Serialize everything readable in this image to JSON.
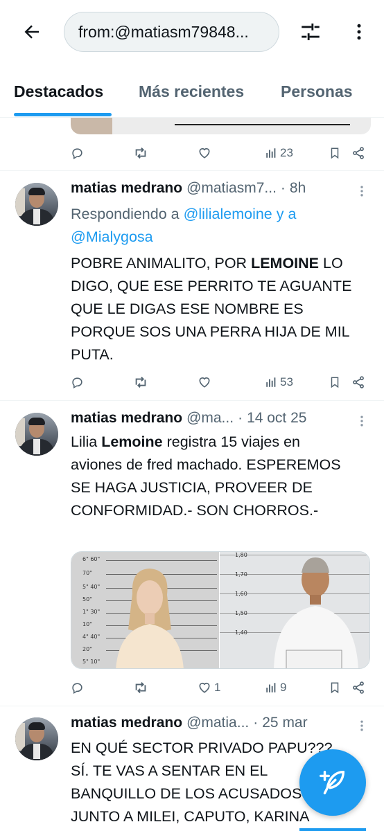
{
  "search": {
    "query": "from:@matiasm79848..."
  },
  "icons": {
    "back": "arrow-left-icon",
    "filter": "sliders-icon",
    "more": "more-vertical-icon",
    "reply": "comment-icon",
    "retweet": "retweet-icon",
    "like": "heart-icon",
    "views": "chart-icon",
    "bookmark": "bookmark-icon",
    "share": "share-icon",
    "compose": "feather-plus-icon"
  },
  "colors": {
    "accent": "#1d9bf0",
    "muted": "#536471",
    "text": "#0f1419"
  },
  "tabs": [
    {
      "label": "Destacados",
      "active": true
    },
    {
      "label": "Más recientes",
      "active": false
    },
    {
      "label": "Personas",
      "active": false
    }
  ],
  "previous_tweet": {
    "views": "23"
  },
  "tweets": [
    {
      "name": "matias medrano",
      "handle": "@matiasm7...",
      "time": "8h",
      "reply_prefix": "Respondiendo a ",
      "reply_user1": "@lilialemoine",
      "reply_and": " y a",
      "reply_user2": "@Mialygosa",
      "text_before": "POBRE ANIMALITO, POR ",
      "text_bold": "LEMOINE",
      "text_after": " LO DIGO, QUE ESE PERRITO TE AGUANTE QUE LE DIGAS ESE NOMBRE ES PORQUE SOS UNA PERRA HIJA DE MIL PUTA.",
      "views": "53",
      "likes": ""
    },
    {
      "name": "matias medrano",
      "handle": "@ma...",
      "time": "14 oct 25",
      "text_before": "Lilia ",
      "text_bold": "Lemoine",
      "text_after": " registra 15 viajes en aviones de fred machado. ESPEREMOS SE HAGA JUSTICIA, PROVEER DE CONFORMIDAD.- SON CHORROS.-",
      "views": "9",
      "likes": "1",
      "media_left_scale": [
        "6\" 60\"",
        "70\"",
        "5\" 40\"",
        "50\"",
        "1\" 30\"",
        "10\"",
        "4\" 40\"",
        "20\"",
        "5\" 10\""
      ],
      "media_right_scale": [
        "1,80",
        "1,70",
        "1,60",
        "1,50",
        "1,40"
      ]
    },
    {
      "name": "matias medrano",
      "handle": "@matia...",
      "time": "25 mar",
      "text": "EN QUÉ SECTOR PRIVADO PAPU???... SÍ. TE VAS A SENTAR EN EL BANQUILLO DE LOS ACUSADOS JUNTO A MILEI, CAPUTO, KARINA"
    }
  ]
}
